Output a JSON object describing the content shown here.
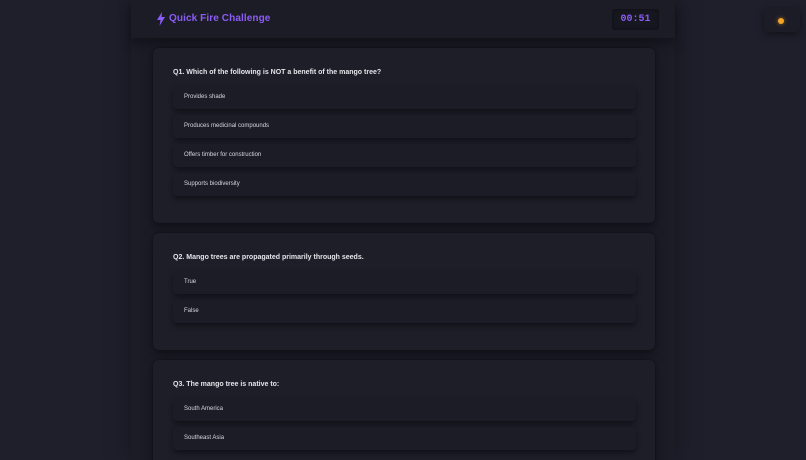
{
  "header": {
    "title": "Quick Fire Challenge",
    "timer": "00:51",
    "bolt_icon": "lightning-icon",
    "accent_color": "#8b5cf6"
  },
  "side_widget": {
    "indicator_icon": "status-dot-icon",
    "indicator_color": "#f5a524"
  },
  "questions": [
    {
      "number": "Q1.",
      "text": "Which of the following is NOT a benefit of the mango tree?",
      "options": [
        "Provides shade",
        "Produces medicinal compounds",
        "Offers timber for construction",
        "Supports biodiversity"
      ]
    },
    {
      "number": "Q2.",
      "text": "Mango trees are propagated primarily through seeds.",
      "options": [
        "True",
        "False"
      ]
    },
    {
      "number": "Q3.",
      "text": "The mango tree is native to:",
      "options": [
        "South America",
        "Southeast Asia"
      ]
    }
  ]
}
